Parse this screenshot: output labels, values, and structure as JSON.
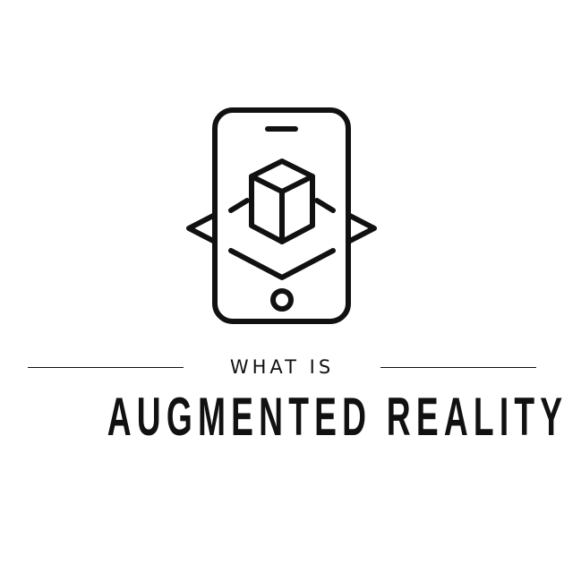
{
  "logo": {
    "icon": "ar-phone-cube-icon",
    "stroke_color": "#111111"
  },
  "heading": {
    "kicker": "WHAT IS",
    "title": "AUGMENTED REALITY"
  },
  "colors": {
    "background": "#ffffff",
    "text": "#111111"
  }
}
